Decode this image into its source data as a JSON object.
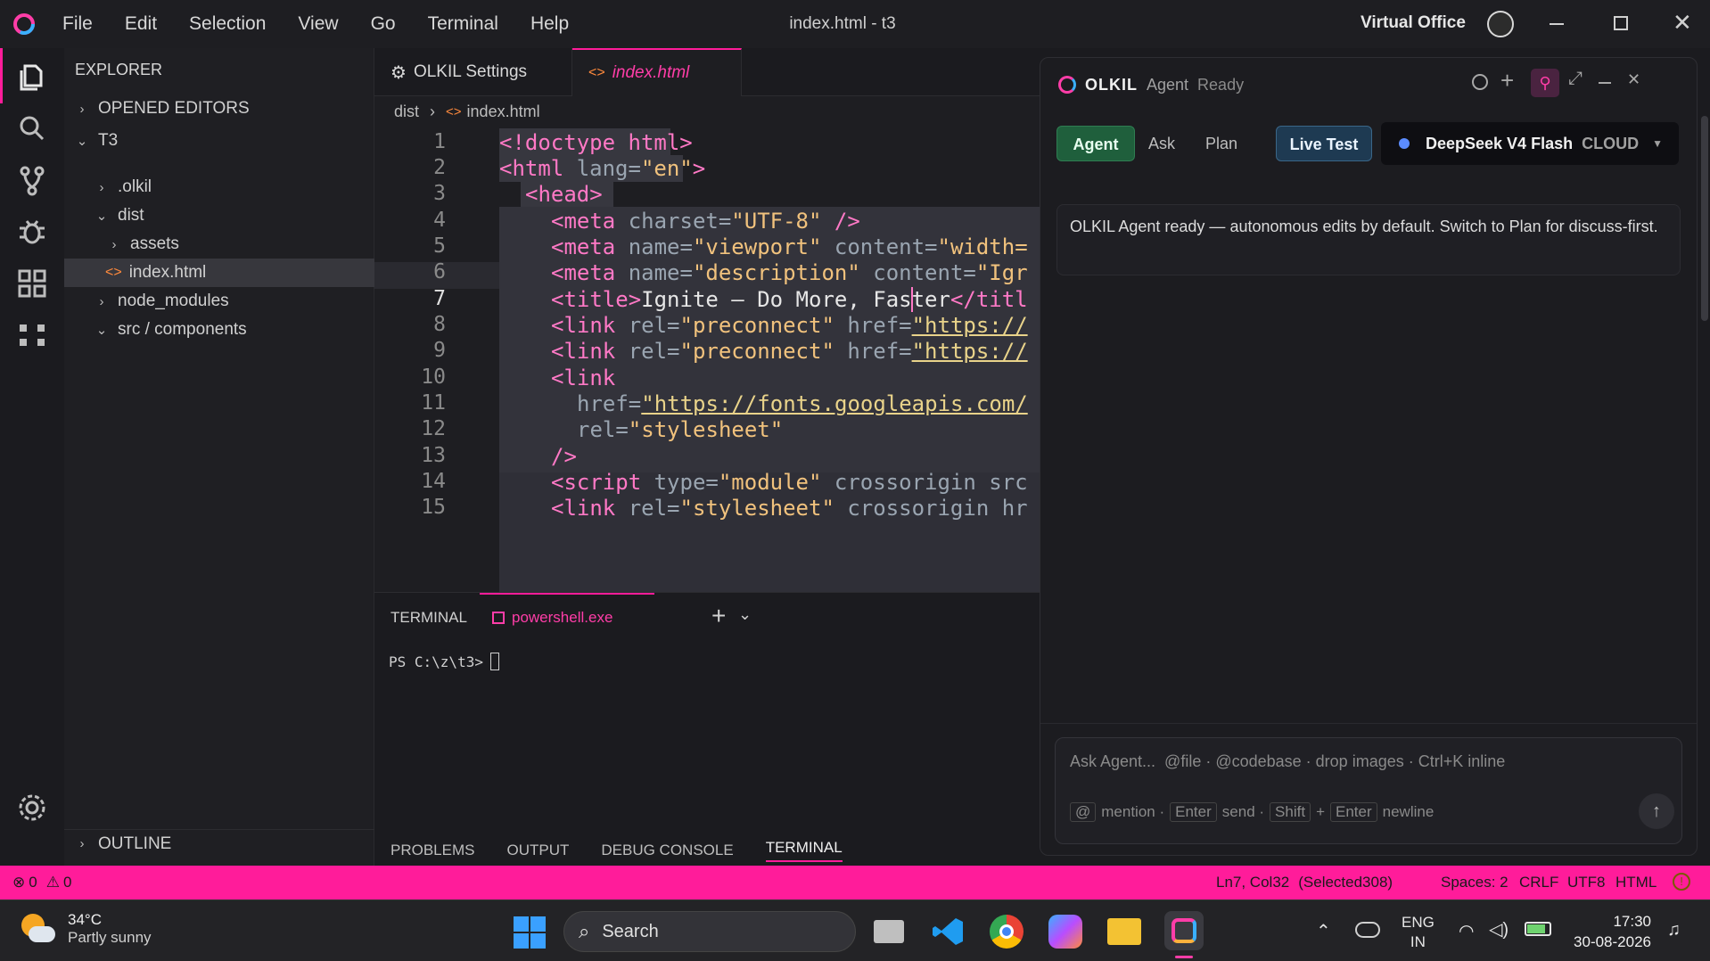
{
  "titlebar": {
    "menu": [
      "File",
      "Edit",
      "Selection",
      "View",
      "Go",
      "Terminal",
      "Help"
    ],
    "title": "index.html - t3",
    "workspace": "Virtual Office"
  },
  "sidebar": {
    "header": "EXPLORER",
    "opened_editors": "OPENED EDITORS",
    "root": "T3",
    "tree": [
      ".olkil",
      "dist",
      "assets",
      "index.html",
      "node_modules",
      "src / components"
    ],
    "outline": "OUTLINE"
  },
  "tabs": [
    {
      "label": "OLKIL Settings"
    },
    {
      "label": "index.html"
    }
  ],
  "breadcrumb": {
    "folder": "dist",
    "file": "index.html"
  },
  "code": {
    "line_numbers": [
      "1",
      "2",
      "3",
      "4",
      "5",
      "6",
      "7",
      "8",
      "9",
      "10",
      "11",
      "12",
      "13",
      "14",
      "15"
    ],
    "lines": {
      "l1": {
        "tag": "<!doctype html>"
      },
      "l2": {
        "open": "<html ",
        "attr": "lang=",
        "val": "\"en\"",
        "close": ">"
      },
      "l3": {
        "tag": "<head>"
      },
      "l4": {
        "open": "<meta ",
        "attr": "charset=",
        "val": "\"UTF-8\"",
        "close": " />"
      },
      "l5": {
        "open": "<meta ",
        "attr": "name=",
        "val": "\"viewport\"",
        "attr2": " content=",
        "val2": "\"width="
      },
      "l6": {
        "open": "<meta ",
        "attr": "name=",
        "val": "\"description\"",
        "attr2": " content=",
        "val2": "\"Igr"
      },
      "l7": {
        "open": "<title>",
        "text": "Ignite — Do More, Faster",
        "close": "</titl"
      },
      "l8": {
        "open": "<link ",
        "attr": "rel=",
        "val": "\"preconnect\"",
        "attr2": " href=",
        "url": "\"https://"
      },
      "l9": {
        "open": "<link ",
        "attr": "rel=",
        "val": "\"preconnect\"",
        "attr2": " href=",
        "url": "\"https://"
      },
      "l10": {
        "open": "<link"
      },
      "l11": {
        "attr": "href=",
        "url": "\"https://fonts.googleapis.com/"
      },
      "l12": {
        "attr": "rel=",
        "val": "\"stylesheet\""
      },
      "l13": {
        "close": "/>"
      },
      "l14": {
        "open": "<script ",
        "attr": "type=",
        "val": "\"module\"",
        "attr2": " crossorigin src"
      },
      "l15": {
        "open": "<link ",
        "attr": "rel=",
        "val": "\"stylesheet\"",
        "attr2": " crossorigin hr"
      }
    }
  },
  "panel": {
    "terminal_label": "TERMINAL",
    "shell_tab": "powershell.exe",
    "prompt": "PS C:\\z\\t3>",
    "bottom_tabs": [
      "PROBLEMS",
      "OUTPUT",
      "DEBUG CONSOLE",
      "TERMINAL"
    ]
  },
  "agent": {
    "brand": "OLKIL",
    "name": "Agent",
    "status": "Ready",
    "modes": [
      "Agent",
      "Ask",
      "Plan"
    ],
    "live_test": "Live Test",
    "model": "DeepSeek V4 Flash",
    "model_tag": "CLOUD",
    "message": "OLKIL Agent ready — autonomous edits by default. Switch to Plan for discuss-first.",
    "composer_placeholder": "Ask Agent...  @file · @codebase · drop images · Ctrl+K inline",
    "hints": {
      "k1": "@",
      "t1": "mention ·",
      "k2": "Enter",
      "t2": "send ·",
      "k3": "Shift",
      "plus": "+",
      "k4": "Enter",
      "t4": "newline"
    }
  },
  "statusbar": {
    "errors": "0",
    "warnings": "0",
    "position": "Ln7, Col32",
    "selected": "(Selected308)",
    "spaces": "Spaces: 2",
    "eol": "CRLF",
    "encoding": "UTF8",
    "language": "HTML"
  },
  "taskbar": {
    "temp": "34°C",
    "weather": "Partly sunny",
    "search": "Search",
    "lang1": "ENG",
    "lang2": "IN",
    "time": "17:30",
    "date": "30-08-2026"
  },
  "colors": {
    "accent": "#ff1c9a",
    "agent_green": "#1f5f3c",
    "live_test": "#1e3a52"
  }
}
